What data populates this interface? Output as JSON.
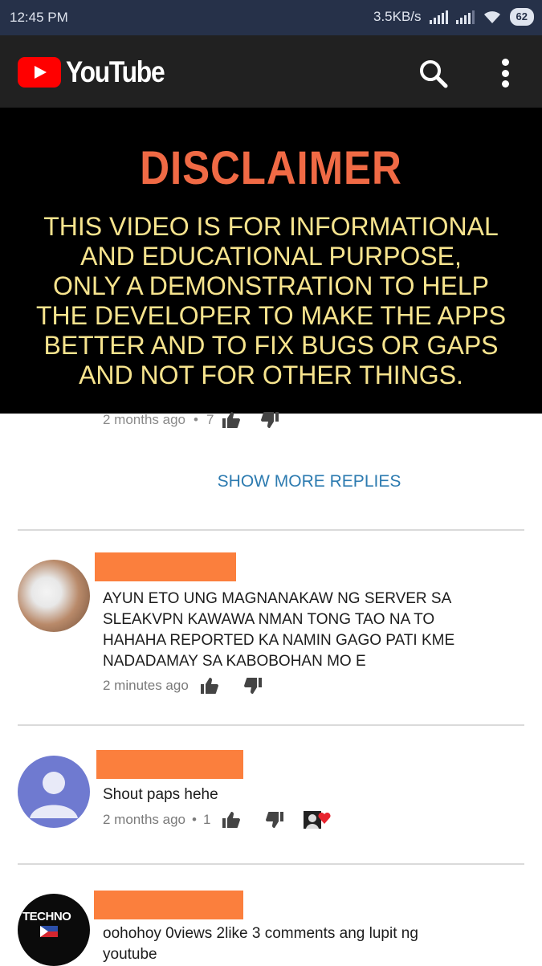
{
  "status_bar": {
    "time": "12:45 PM",
    "speed": "3.5KB/s",
    "battery": "62"
  },
  "app_bar": {
    "brand": "YouTube"
  },
  "video": {
    "title": "DISCLAIMER",
    "lines": [
      "THIS VIDEO IS FOR INFORMATIONAL",
      "AND EDUCATIONAL PURPOSE,",
      "ONLY A DEMONSTRATION TO HELP",
      "THE DEVELOPER TO MAKE THE APPS",
      "BETTER AND TO FIX BUGS OR GAPS",
      "AND NOT FOR OTHER THINGS."
    ]
  },
  "partial_reply": {
    "time": "2 months ago",
    "likes": "7"
  },
  "show_more_label": "SHOW MORE REPLIES",
  "comments": [
    {
      "text_lines": [
        "AYUN ETO UNG MAGNANAKAW NG SERVER SA",
        "SLEAKVPN KAWAWA NMAN TONG TAO NA TO",
        "HAHAHA REPORTED KA NAMIN GAGO PATI KME",
        "NADADAMAY SA KABOBOHAN MO E"
      ],
      "time": "2 minutes ago"
    },
    {
      "text": "Shout paps hehe",
      "time": "2 months ago",
      "likes": "1"
    },
    {
      "text_lines": [
        "oohohoy 0views 2like 3 comments ang lupit ng",
        "youtube"
      ],
      "avatar_label": "TECHNO"
    }
  ],
  "colors": {
    "status_bg": "#263149",
    "appbar_bg": "#212121",
    "yt_red": "#ff0000",
    "disclaimer_title": "#f06a45",
    "disclaimer_text": "#f7e48e",
    "link_blue": "#2d7bb0",
    "redaction": "#fb7f3d"
  },
  "icons": [
    "search-icon",
    "more-vert-icon",
    "thumbs-up-icon",
    "thumbs-down-icon",
    "heart-icon"
  ]
}
